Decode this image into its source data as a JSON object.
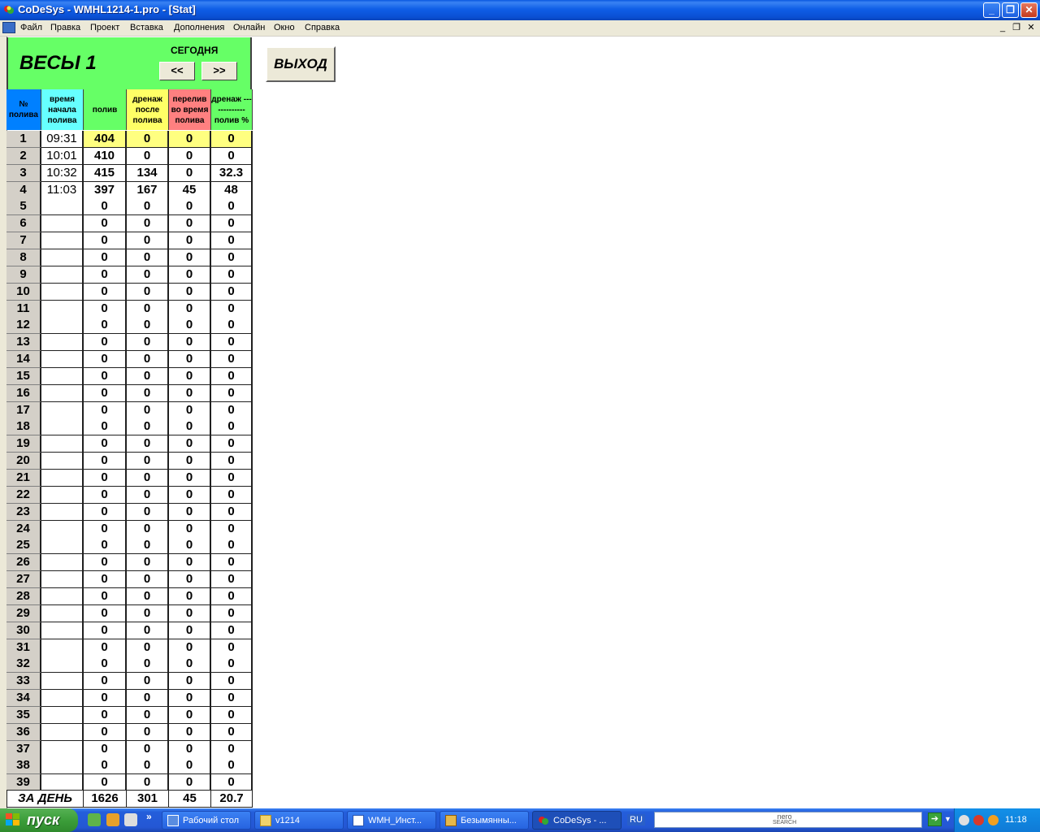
{
  "window": {
    "title": "CoDeSys - WMHL1214-1.pro - [Stat]",
    "minimize": "_",
    "maximize": "❐",
    "close": "✕"
  },
  "menu": {
    "items": [
      "Файл",
      "Правка",
      "Проект",
      "Вставка",
      "Дополнения",
      "Онлайн",
      "Окно",
      "Справка"
    ],
    "mdi_minimize": "_",
    "mdi_restore": "❐",
    "mdi_close": "✕"
  },
  "vis": {
    "title": "ВЕСЫ 1",
    "today_label": "СЕГОДНЯ",
    "prev_label": "<<",
    "next_label": ">>",
    "exit_label": "ВЫХОД",
    "columns": [
      {
        "label": "№ полива",
        "color": "#0080ff"
      },
      {
        "label": "время начала полива",
        "color": "#66ffff"
      },
      {
        "label": "полив",
        "color": "#66ff66"
      },
      {
        "label": "дренаж после полива",
        "color": "#ffff66"
      },
      {
        "label": "перелив во время полива",
        "color": "#ff8080"
      },
      {
        "label": "дренаж ------------- полив %",
        "color": "#66ff66"
      }
    ],
    "rows": [
      {
        "n": "1",
        "time": "09:31",
        "poliv": "404",
        "drain": "0",
        "overflow": "0",
        "pct": "0",
        "highlight": true
      },
      {
        "n": "2",
        "time": "10:01",
        "poliv": "410",
        "drain": "0",
        "overflow": "0",
        "pct": "0"
      },
      {
        "n": "3",
        "time": "10:32",
        "poliv": "415",
        "drain": "134",
        "overflow": "0",
        "pct": "32.3"
      },
      {
        "n": "4",
        "time": "11:03",
        "poliv": "397",
        "drain": "167",
        "overflow": "45",
        "pct": "48"
      },
      {
        "n": "5",
        "time": "",
        "poliv": "0",
        "drain": "0",
        "overflow": "0",
        "pct": "0"
      },
      {
        "n": "6",
        "time": "",
        "poliv": "0",
        "drain": "0",
        "overflow": "0",
        "pct": "0"
      },
      {
        "n": "7",
        "time": "",
        "poliv": "0",
        "drain": "0",
        "overflow": "0",
        "pct": "0"
      },
      {
        "n": "8",
        "time": "",
        "poliv": "0",
        "drain": "0",
        "overflow": "0",
        "pct": "0"
      },
      {
        "n": "9",
        "time": "",
        "poliv": "0",
        "drain": "0",
        "overflow": "0",
        "pct": "0"
      },
      {
        "n": "10",
        "time": "",
        "poliv": "0",
        "drain": "0",
        "overflow": "0",
        "pct": "0"
      },
      {
        "n": "11",
        "time": "",
        "poliv": "0",
        "drain": "0",
        "overflow": "0",
        "pct": "0"
      },
      {
        "n": "12",
        "time": "",
        "poliv": "0",
        "drain": "0",
        "overflow": "0",
        "pct": "0"
      },
      {
        "n": "13",
        "time": "",
        "poliv": "0",
        "drain": "0",
        "overflow": "0",
        "pct": "0"
      },
      {
        "n": "14",
        "time": "",
        "poliv": "0",
        "drain": "0",
        "overflow": "0",
        "pct": "0"
      },
      {
        "n": "15",
        "time": "",
        "poliv": "0",
        "drain": "0",
        "overflow": "0",
        "pct": "0"
      },
      {
        "n": "16",
        "time": "",
        "poliv": "0",
        "drain": "0",
        "overflow": "0",
        "pct": "0"
      },
      {
        "n": "17",
        "time": "",
        "poliv": "0",
        "drain": "0",
        "overflow": "0",
        "pct": "0"
      },
      {
        "n": "18",
        "time": "",
        "poliv": "0",
        "drain": "0",
        "overflow": "0",
        "pct": "0"
      },
      {
        "n": "19",
        "time": "",
        "poliv": "0",
        "drain": "0",
        "overflow": "0",
        "pct": "0"
      },
      {
        "n": "20",
        "time": "",
        "poliv": "0",
        "drain": "0",
        "overflow": "0",
        "pct": "0"
      },
      {
        "n": "21",
        "time": "",
        "poliv": "0",
        "drain": "0",
        "overflow": "0",
        "pct": "0"
      },
      {
        "n": "22",
        "time": "",
        "poliv": "0",
        "drain": "0",
        "overflow": "0",
        "pct": "0"
      },
      {
        "n": "23",
        "time": "",
        "poliv": "0",
        "drain": "0",
        "overflow": "0",
        "pct": "0"
      },
      {
        "n": "24",
        "time": "",
        "poliv": "0",
        "drain": "0",
        "overflow": "0",
        "pct": "0"
      },
      {
        "n": "25",
        "time": "",
        "poliv": "0",
        "drain": "0",
        "overflow": "0",
        "pct": "0"
      },
      {
        "n": "26",
        "time": "",
        "poliv": "0",
        "drain": "0",
        "overflow": "0",
        "pct": "0"
      },
      {
        "n": "27",
        "time": "",
        "poliv": "0",
        "drain": "0",
        "overflow": "0",
        "pct": "0"
      },
      {
        "n": "28",
        "time": "",
        "poliv": "0",
        "drain": "0",
        "overflow": "0",
        "pct": "0"
      },
      {
        "n": "29",
        "time": "",
        "poliv": "0",
        "drain": "0",
        "overflow": "0",
        "pct": "0"
      },
      {
        "n": "30",
        "time": "",
        "poliv": "0",
        "drain": "0",
        "overflow": "0",
        "pct": "0"
      },
      {
        "n": "31",
        "time": "",
        "poliv": "0",
        "drain": "0",
        "overflow": "0",
        "pct": "0"
      },
      {
        "n": "32",
        "time": "",
        "poliv": "0",
        "drain": "0",
        "overflow": "0",
        "pct": "0"
      },
      {
        "n": "33",
        "time": "",
        "poliv": "0",
        "drain": "0",
        "overflow": "0",
        "pct": "0"
      },
      {
        "n": "34",
        "time": "",
        "poliv": "0",
        "drain": "0",
        "overflow": "0",
        "pct": "0"
      },
      {
        "n": "35",
        "time": "",
        "poliv": "0",
        "drain": "0",
        "overflow": "0",
        "pct": "0"
      },
      {
        "n": "36",
        "time": "",
        "poliv": "0",
        "drain": "0",
        "overflow": "0",
        "pct": "0"
      },
      {
        "n": "37",
        "time": "",
        "poliv": "0",
        "drain": "0",
        "overflow": "0",
        "pct": "0"
      },
      {
        "n": "38",
        "time": "",
        "poliv": "0",
        "drain": "0",
        "overflow": "0",
        "pct": "0"
      },
      {
        "n": "39",
        "time": "",
        "poliv": "0",
        "drain": "0",
        "overflow": "0",
        "pct": "0"
      }
    ],
    "total": {
      "label": "ЗА ДЕНЬ",
      "poliv": "1626",
      "drain": "301",
      "overflow": "45",
      "pct": "20.7"
    },
    "highlight_color": "#ffff80",
    "header_bg": "#66ff66"
  },
  "taskbar": {
    "start_label": "пуск",
    "quicklaunch_more": "»",
    "tasks": [
      {
        "label": "Рабочий стол",
        "icon": "desktop-icon"
      },
      {
        "label": "v1214",
        "icon": "folder-icon"
      },
      {
        "label": "WMH_Инст...",
        "icon": "word-document-icon"
      },
      {
        "label": "Безымянны...",
        "icon": "paint-icon"
      },
      {
        "label": "CoDeSys - ...",
        "icon": "codesys-icon",
        "active": true
      }
    ],
    "language": "RU",
    "search_brand_line1": "nero",
    "search_brand_line2": "SEARCH",
    "clock": "11:18"
  }
}
